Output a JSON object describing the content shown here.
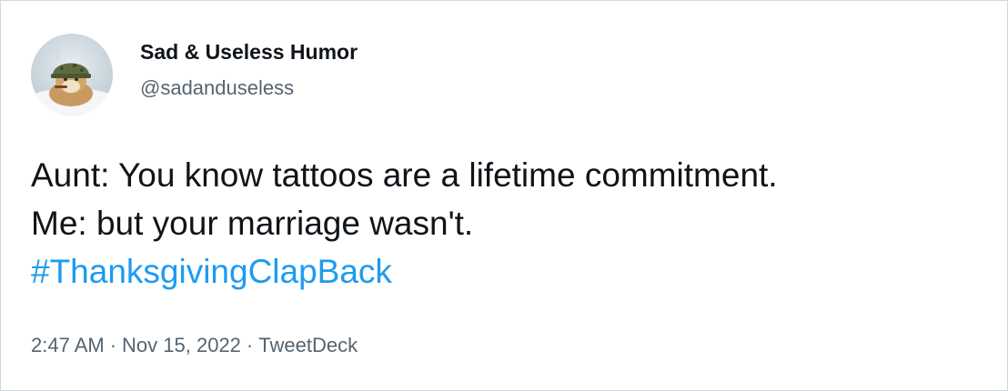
{
  "user": {
    "display_name": "Sad & Useless Humor",
    "handle": "@sadanduseless",
    "avatar_icon": "soldier-cat-avatar-icon"
  },
  "tweet": {
    "line1": "Aunt: You know tattoos are a lifetime commitment.",
    "line2": "Me: but your marriage wasn't.",
    "hashtag": "#ThanksgivingClapBack"
  },
  "meta": {
    "time": "2:47 AM",
    "separator": "·",
    "date": "Nov 15, 2022",
    "source": "TweetDeck"
  },
  "colors": {
    "text": "#0f1419",
    "secondary": "#536471",
    "link": "#1d9bf0",
    "border": "#cfd9de"
  }
}
